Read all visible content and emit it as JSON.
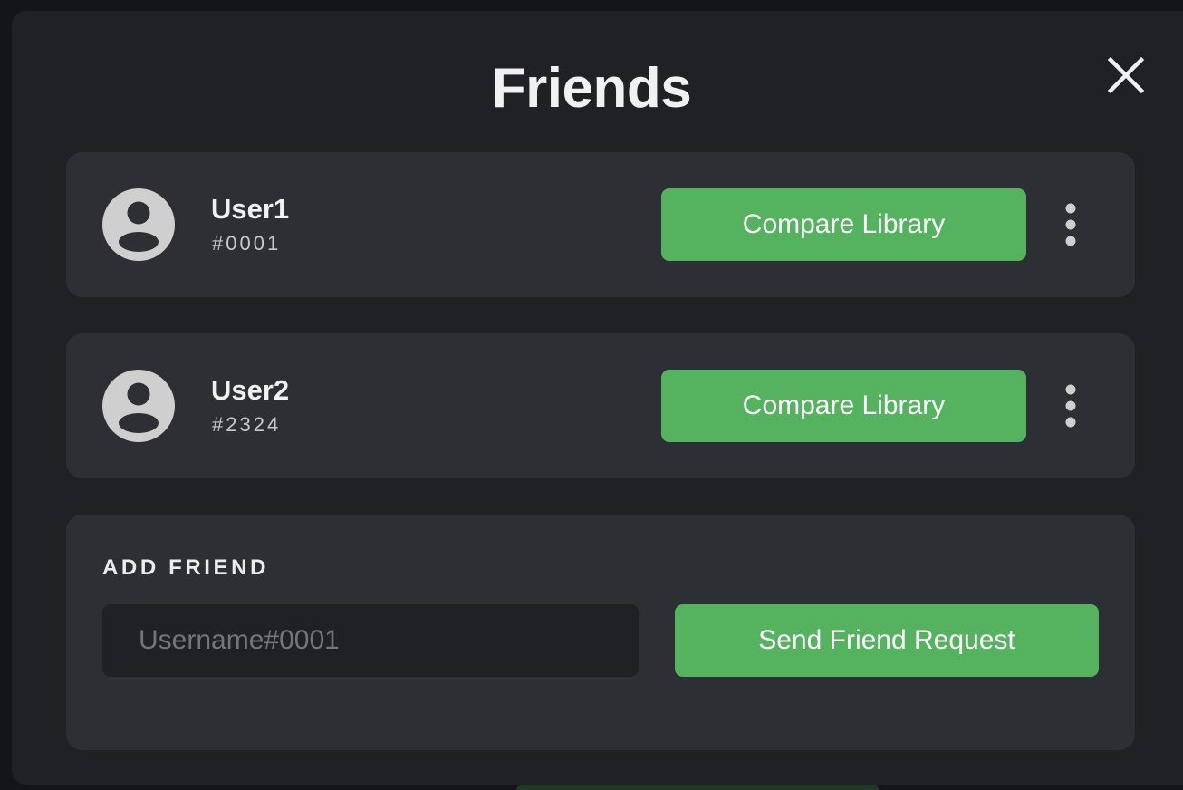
{
  "dialog": {
    "title": "Friends",
    "close_icon": "close-icon"
  },
  "friends": [
    {
      "name": "User1",
      "tag": "#0001",
      "compare_label": "Compare Library",
      "avatar_icon": "user-avatar-icon",
      "menu_icon": "more-vertical-icon"
    },
    {
      "name": "User2",
      "tag": "#2324",
      "compare_label": "Compare Library",
      "avatar_icon": "user-avatar-icon",
      "menu_icon": "more-vertical-icon"
    }
  ],
  "add_friend": {
    "label": "ADD FRIEND",
    "input_value": "",
    "input_placeholder": "Username#0001",
    "send_label": "Send Friend Request"
  },
  "colors": {
    "accent_green": "#55b35f",
    "modal_bg": "#202125",
    "card_bg": "#2e2f34",
    "avatar_gray": "#cfcfcf"
  }
}
